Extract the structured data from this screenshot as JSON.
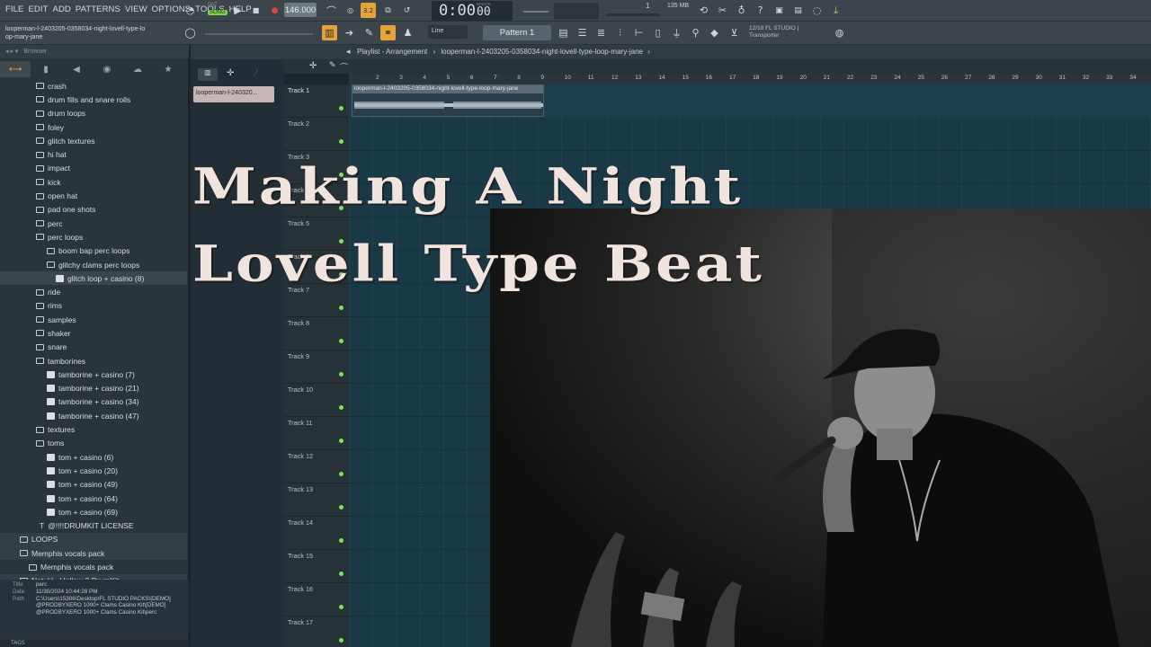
{
  "menu": [
    "FILE",
    "EDIT",
    "ADD",
    "PATTERNS",
    "VIEW",
    "OPTIONS",
    "TOOLS",
    "HELP"
  ],
  "transport": {
    "pat_label": "PAT",
    "song_label": "SONG",
    "tempo": "146.000",
    "time": "0:00",
    "time_small": "00",
    "time_unit": "M:S:CS",
    "cpu_num": "1",
    "memory": "135 MB",
    "tb_badge": "3.2"
  },
  "hint": {
    "line1": "looperman-l-2403205-0358034-night-lovell-type-lo",
    "line2": "op-mary-jane"
  },
  "toolbar2": {
    "snap": "Line",
    "pattern": "Pattern 1",
    "news_line1": "12/18  FL STUDIO |",
    "news_line2": "Transporter"
  },
  "browser": {
    "header": "Browser",
    "tabs": [
      "browser-all",
      "browser-files",
      "browser-plugins",
      "browser-cloud",
      "browser-starred"
    ],
    "items": [
      {
        "label": "crash",
        "type": "folder",
        "indent": 40
      },
      {
        "label": "drum fills and snare rolls",
        "type": "folder",
        "indent": 40
      },
      {
        "label": "drum loops",
        "type": "folder",
        "indent": 40
      },
      {
        "label": "foley",
        "type": "folder",
        "indent": 40
      },
      {
        "label": "glitch textures",
        "type": "folder",
        "indent": 40
      },
      {
        "label": "hi hat",
        "type": "folder",
        "indent": 40
      },
      {
        "label": "impact",
        "type": "folder",
        "indent": 40
      },
      {
        "label": "kick",
        "type": "folder",
        "indent": 40
      },
      {
        "label": "open hat",
        "type": "folder",
        "indent": 40
      },
      {
        "label": "pad one shots",
        "type": "folder",
        "indent": 40
      },
      {
        "label": "perc",
        "type": "folder",
        "indent": 40
      },
      {
        "label": "perc loops",
        "type": "folder",
        "indent": 40
      },
      {
        "label": "boom bap perc loops",
        "type": "folder",
        "indent": 52
      },
      {
        "label": "glitchy clams perc loops",
        "type": "folder",
        "indent": 52
      },
      {
        "label": "glitch loop + casino (8)",
        "type": "audio",
        "indent": 62
      },
      {
        "label": "ride",
        "type": "folder",
        "indent": 40
      },
      {
        "label": "rims",
        "type": "folder",
        "indent": 40
      },
      {
        "label": "samples",
        "type": "folder",
        "indent": 40
      },
      {
        "label": "shaker",
        "type": "folder",
        "indent": 40
      },
      {
        "label": "snare",
        "type": "folder",
        "indent": 40
      },
      {
        "label": "tamborines",
        "type": "folder",
        "indent": 40
      },
      {
        "label": "tamborine + casino (7)",
        "type": "audio",
        "indent": 52
      },
      {
        "label": "tamborine + casino (21)",
        "type": "audio",
        "indent": 52
      },
      {
        "label": "tamborine + casino (34)",
        "type": "audio",
        "indent": 52
      },
      {
        "label": "tamborine + casino (47)",
        "type": "audio",
        "indent": 52
      },
      {
        "label": "textures",
        "type": "folder",
        "indent": 40
      },
      {
        "label": "toms",
        "type": "folder",
        "indent": 40
      },
      {
        "label": "tom + casino (6)",
        "type": "audio",
        "indent": 52
      },
      {
        "label": "tom + casino (20)",
        "type": "audio",
        "indent": 52
      },
      {
        "label": "tom + casino (49)",
        "type": "audio",
        "indent": 52
      },
      {
        "label": "tom + casino (64)",
        "type": "audio",
        "indent": 52
      },
      {
        "label": "tom + casino (69)",
        "type": "audio",
        "indent": 52
      },
      {
        "label": "@!!!!DRUMKIT LICENSE",
        "type": "text",
        "indent": 44
      },
      {
        "label": "LOOPS",
        "type": "folder",
        "indent": 22
      },
      {
        "label": "Memphis vocals pack",
        "type": "folder",
        "indent": 22
      },
      {
        "label": "Memphis vocals pack",
        "type": "folder",
        "indent": 32
      },
      {
        "label": "NatuH - Hellow 2 DrumKit",
        "type": "folder",
        "indent": 22
      }
    ],
    "info": {
      "title_key": "Title",
      "title_val": "perc",
      "date_key": "Date",
      "date_val": "11/30/2024 10:44:28 PM",
      "path_key": "Path",
      "path_val": "C:\\Users\\15306\\Desktop\\FL STUDIO PACKS\\[DEMO] @PRODBYXERO 1000+ Clams Casino Kit\\[DEMO] @PRODBYXERO 1000+ Clams Casino Kit\\perc"
    },
    "bottom": "TAGS"
  },
  "playlist": {
    "title": "Playlist - Arrangement",
    "crumb": "looperman-l-2403205-0358034-night-lovell-type-loop-mary-jane",
    "picker_clip": "looperman-l-240320...",
    "clip_label": "looperman-l-2403205-0358034-night-lovell-type-loop-mary-jane",
    "tracks": [
      "Track 1",
      "Track 2",
      "Track 3",
      "Track 4",
      "Track 5",
      "Track 6",
      "Track 7",
      "Track 8",
      "Track 9",
      "Track 10",
      "Track 11",
      "Track 12",
      "Track 13",
      "Track 14",
      "Track 15",
      "Track 16",
      "Track 17"
    ],
    "bars": [
      "2",
      "3",
      "4",
      "5",
      "6",
      "7",
      "8",
      "9",
      "10",
      "11",
      "12",
      "13",
      "14",
      "15",
      "16",
      "17",
      "18",
      "19",
      "20",
      "21",
      "22",
      "23",
      "24",
      "25",
      "26",
      "27",
      "28",
      "29",
      "30",
      "31",
      "32",
      "33",
      "34"
    ]
  },
  "overlay": {
    "line1": "Making A Night",
    "line2": "Lovell Type Beat"
  }
}
